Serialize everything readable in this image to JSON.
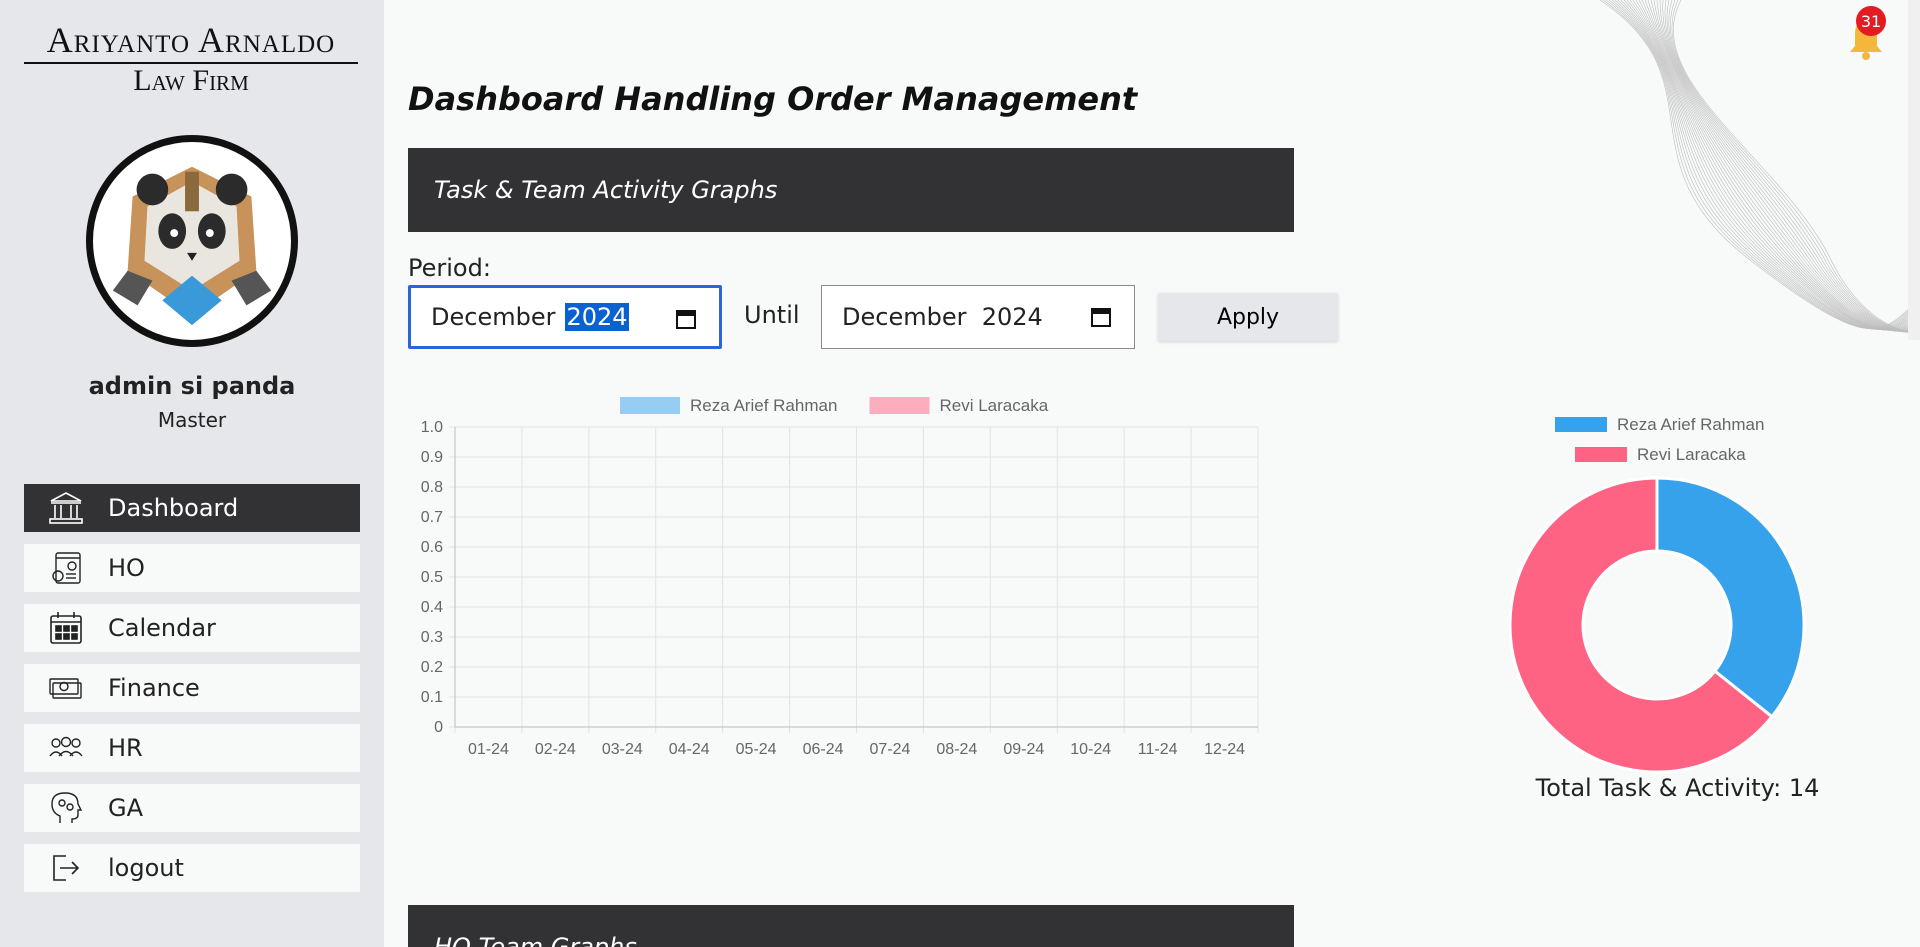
{
  "sidebar": {
    "logo": {
      "line1": "Ariyanto Arnaldo",
      "line2": "Law Firm"
    },
    "user": {
      "name": "admin si panda",
      "role": "Master"
    },
    "items": [
      {
        "label": "Dashboard",
        "icon": "bank-icon",
        "active": true
      },
      {
        "label": "HO",
        "icon": "settings-document-icon"
      },
      {
        "label": "Calendar",
        "icon": "calendar-icon"
      },
      {
        "label": "Finance",
        "icon": "cash-icon"
      },
      {
        "label": "HR",
        "icon": "team-icon"
      },
      {
        "label": "GA",
        "icon": "head-gears-icon"
      },
      {
        "label": "logout",
        "icon": "logout-icon"
      }
    ]
  },
  "header": {
    "title": "Dashboard Handling Order Management"
  },
  "notifications": {
    "count": "31"
  },
  "sections": {
    "task_team": "Task & Team Activity Graphs",
    "ho_team": "HO Team Graphs"
  },
  "period": {
    "label": "Period:",
    "from_month": "December",
    "from_year": "2024",
    "until_label": "Until",
    "to_value": "December  2024",
    "apply_label": "Apply"
  },
  "total_label": "Total Task & Activity: 14",
  "colors": {
    "blue": "#36a2eb",
    "pink": "#ff6384",
    "dark": "#323234"
  },
  "chart_data": [
    {
      "type": "bar",
      "categories": [
        "01-24",
        "02-24",
        "03-24",
        "04-24",
        "05-24",
        "06-24",
        "07-24",
        "08-24",
        "09-24",
        "10-24",
        "11-24",
        "12-24"
      ],
      "series": [
        {
          "name": "Reza Arief Rahman",
          "values": [
            0,
            0,
            0,
            0,
            0,
            0,
            0,
            0,
            0,
            0,
            0,
            0
          ],
          "color": "#36a2eb"
        },
        {
          "name": "Revi Laracaka",
          "values": [
            0,
            0,
            0,
            0,
            0,
            0,
            0,
            0,
            0,
            0,
            0,
            0
          ],
          "color": "#ff6384"
        }
      ],
      "ylim": [
        0,
        1.0
      ],
      "yticks": [
        "0",
        "0.1",
        "0.2",
        "0.3",
        "0.4",
        "0.5",
        "0.6",
        "0.7",
        "0.8",
        "0.9",
        "1.0"
      ],
      "grid": true,
      "legend": "top"
    },
    {
      "type": "pie",
      "variant": "doughnut",
      "labels": [
        "Reza Arief Rahman",
        "Revi Laracaka"
      ],
      "values": [
        5,
        9
      ],
      "colors": [
        "#36a2eb",
        "#ff6384"
      ],
      "legend": "top"
    }
  ]
}
